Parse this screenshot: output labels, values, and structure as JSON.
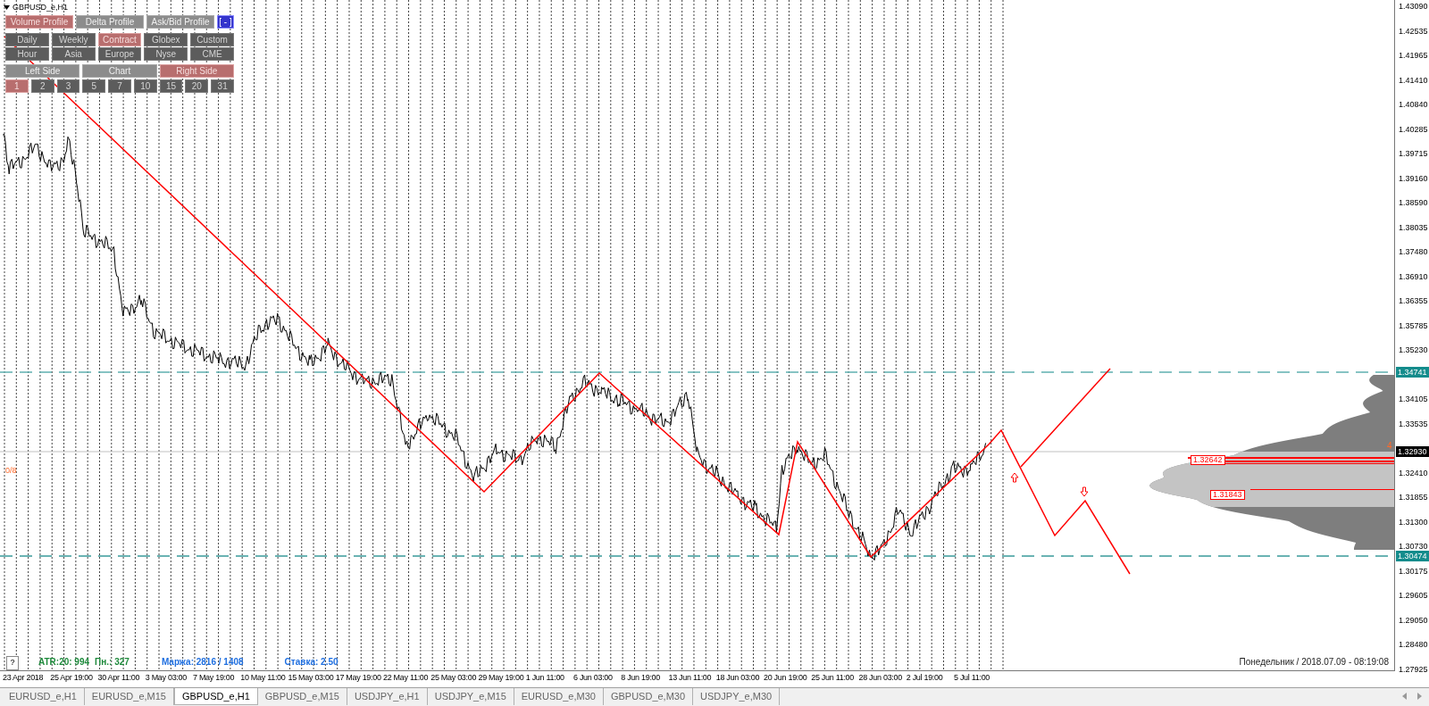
{
  "chart": {
    "title": "GBPUSD_e,H1",
    "price_levels": [
      "1.43090",
      "1.42535",
      "1.41965",
      "1.41410",
      "1.40840",
      "1.40285",
      "1.39715",
      "1.39160",
      "1.38590",
      "1.38035",
      "1.37480",
      "1.36910",
      "1.36355",
      "1.35785",
      "1.35230",
      "1.34105",
      "1.33535",
      "1.32410",
      "1.31855",
      "1.31300",
      "1.30730",
      "1.30175",
      "1.29605",
      "1.29050",
      "1.28480",
      "1.27925"
    ],
    "level_tags": [
      {
        "label": "1.34741",
        "kind": "level"
      },
      {
        "label": "1.32930",
        "kind": "bid"
      },
      {
        "label": "1.30474",
        "kind": "level"
      }
    ],
    "profile_tags": [
      "1.32642",
      "1.31843"
    ],
    "time_labels": [
      "23 Apr 2018",
      "25 Apr 19:00",
      "30 Apr 11:00",
      "3 May 03:00",
      "7 May 19:00",
      "10 May 11:00",
      "15 May 03:00",
      "17 May 19:00",
      "22 May 11:00",
      "25 May 03:00",
      "29 May 19:00",
      "1 Jun 11:00",
      "6 Jun 03:00",
      "8 Jun 19:00",
      "13 Jun 11:00",
      "18 Jun 03:00",
      "20 Jun 19:00",
      "25 Jun 11:00",
      "28 Jun 03:00",
      "2 Jul 19:00",
      "5 Jul 11:00"
    ],
    "left_marker": "0/8",
    "right_marker": "4",
    "datetime": "Понедельник / 2018.07.09 - 08:19:08"
  },
  "panel": {
    "profile_buttons": [
      {
        "label": "Volume Profile",
        "kind": "profile",
        "selected": true
      },
      {
        "label": "Delta Profile",
        "kind": "profile",
        "selected": false
      },
      {
        "label": "Ask/Bid Profile",
        "kind": "profile",
        "selected": false
      },
      {
        "label": "[ - ]",
        "kind": "toggle",
        "selected": false
      }
    ],
    "period_buttons": [
      {
        "label": "Daily",
        "selected": false
      },
      {
        "label": "Weekly",
        "selected": false
      },
      {
        "label": "Contract",
        "selected": true
      },
      {
        "label": "Globex",
        "selected": false
      },
      {
        "label": "Custom",
        "selected": false
      }
    ],
    "session_buttons": [
      {
        "label": "Hour",
        "selected": false
      },
      {
        "label": "Asia",
        "selected": false
      },
      {
        "label": "Europe",
        "selected": false
      },
      {
        "label": "Nyse",
        "selected": false
      },
      {
        "label": "CME",
        "selected": false
      }
    ],
    "side_buttons": [
      {
        "label": "Left Side",
        "selected": false
      },
      {
        "label": "Chart",
        "selected": false
      },
      {
        "label": "Right Side",
        "selected": true
      }
    ],
    "day_buttons": [
      {
        "label": "1",
        "selected": true
      },
      {
        "label": "2",
        "selected": false
      },
      {
        "label": "3",
        "selected": false
      },
      {
        "label": "5",
        "selected": false
      },
      {
        "label": "7",
        "selected": false
      },
      {
        "label": "10",
        "selected": false
      },
      {
        "label": "15",
        "selected": false
      },
      {
        "label": "20",
        "selected": false
      },
      {
        "label": "31",
        "selected": false
      }
    ]
  },
  "info": {
    "help": "?",
    "atr": "ATR:20: 994",
    "day": "Пн.: 327",
    "margin": "Маржа: 2816 / 1408",
    "rate": "Ставка: 2.50"
  },
  "tabs": [
    {
      "label": "EURUSD_e,H1",
      "selected": false
    },
    {
      "label": "EURUSD_e,M15",
      "selected": false
    },
    {
      "label": "GBPUSD_e,H1",
      "selected": true
    },
    {
      "label": "GBPUSD_e,M15",
      "selected": false
    },
    {
      "label": "USDJPY_e,H1",
      "selected": false
    },
    {
      "label": "USDJPY_e,M15",
      "selected": false
    },
    {
      "label": "EURUSD_e,M30",
      "selected": false
    },
    {
      "label": "GBPUSD_e,M30",
      "selected": false
    },
    {
      "label": "USDJPY_e,M30",
      "selected": false
    }
  ]
}
